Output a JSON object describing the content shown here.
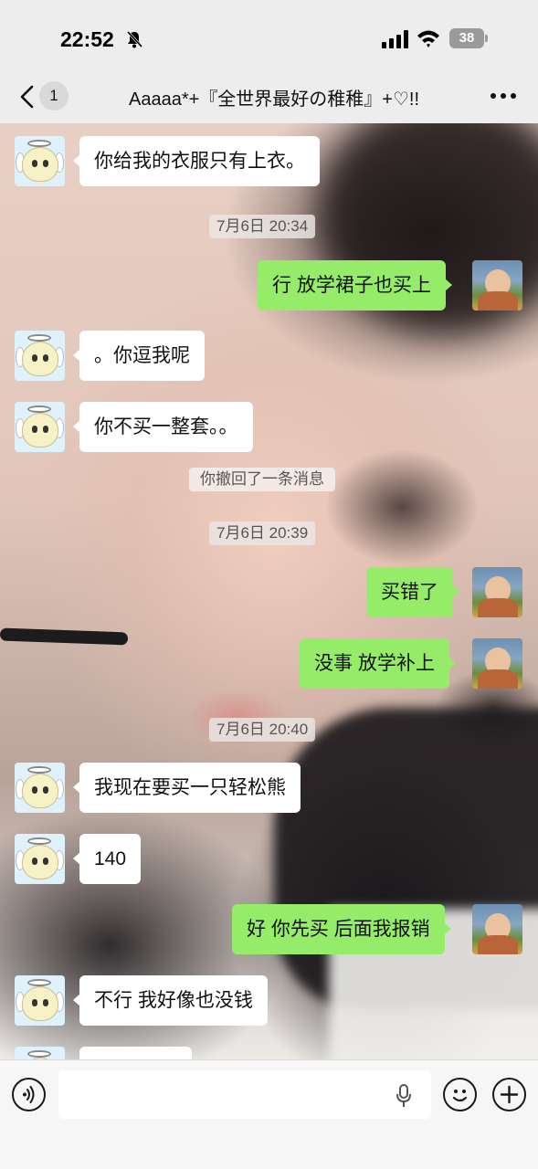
{
  "status_bar": {
    "time": "22:52",
    "battery_level": "38",
    "icons": [
      "bell-off-icon",
      "signal-icon",
      "wifi-icon",
      "battery-icon"
    ]
  },
  "nav": {
    "unread_count": "1",
    "title": "Aaaaa*+『全世界最好の稚稚』+♡!!",
    "icons": [
      "back-icon",
      "more-icon"
    ]
  },
  "messages": [
    {
      "side": "left",
      "text": "你给我的衣服只有上衣。"
    },
    {
      "type": "timestamp",
      "text": "7月6日 20:34"
    },
    {
      "side": "right",
      "text": "行 放学裙子也买上"
    },
    {
      "side": "left",
      "text": "。你逗我呢"
    },
    {
      "side": "left",
      "text": "你不买一整套。。"
    },
    {
      "type": "system",
      "text": "你撤回了一条消息"
    },
    {
      "type": "timestamp",
      "text": "7月6日 20:39"
    },
    {
      "side": "right",
      "text": "买错了"
    },
    {
      "side": "right",
      "text": "没事 放学补上"
    },
    {
      "type": "timestamp",
      "text": "7月6日 20:40"
    },
    {
      "side": "left",
      "text": "我现在要买一只轻松熊"
    },
    {
      "side": "left",
      "text": "140"
    },
    {
      "side": "right",
      "text": "好 你先买 后面我报销"
    },
    {
      "side": "left",
      "text": "不行 我好像也没钱"
    },
    {
      "side": "left",
      "text": ""
    }
  ],
  "input_bar": {
    "placeholder": "",
    "icons": [
      "voice-icon",
      "mic-icon",
      "emoji-icon",
      "add-icon"
    ]
  },
  "colors": {
    "bar_background": "#ededed",
    "self_bubble": "#95ec69",
    "other_bubble": "#ffffff",
    "input_background": "#f6f6f6"
  }
}
